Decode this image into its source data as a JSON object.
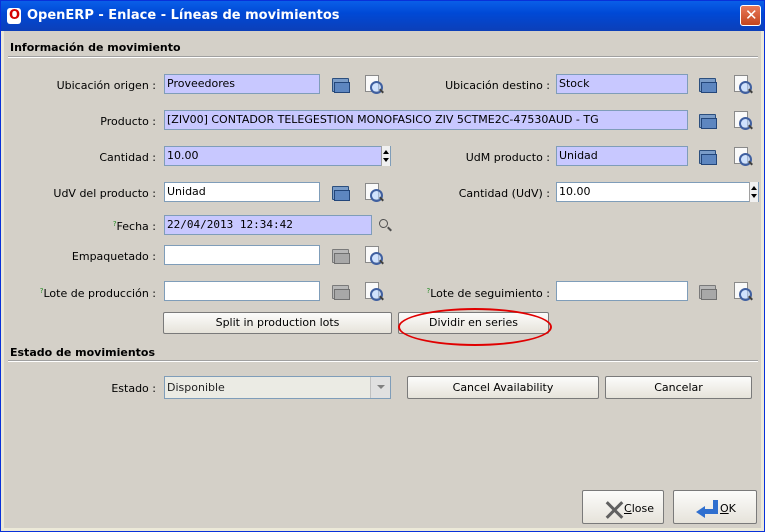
{
  "window": {
    "title": "OpenERP - Enlace - Líneas de movimientos",
    "logo_letter": "O",
    "close_glyph": "✕"
  },
  "section1": {
    "title": "Información de movimiento"
  },
  "section2": {
    "title": "Estado de movimientos"
  },
  "fields": {
    "ubicacion_origen": {
      "label": "Ubicación origen :",
      "value": "Proveedores"
    },
    "ubicacion_destino": {
      "label": "Ubicación destino :",
      "value": "Stock"
    },
    "producto": {
      "label": "Producto :",
      "value": "[ZIV00] CONTADOR TELEGESTION MONOFASICO ZIV 5CTME2C-47530AUD - TG"
    },
    "cantidad": {
      "label": "Cantidad :",
      "value": "10.00"
    },
    "udm_producto": {
      "label": "UdM producto :",
      "value": "Unidad"
    },
    "udv_producto": {
      "label": "UdV del producto :",
      "value": "Unidad"
    },
    "cantidad_udv": {
      "label": "Cantidad (UdV) :",
      "value": "10.00"
    },
    "fecha": {
      "label_mark": "?",
      "label": "Fecha :",
      "value": "22/04/2013 12:34:42"
    },
    "empaquetado": {
      "label": "Empaquetado :",
      "value": ""
    },
    "lote_produccion": {
      "label_mark": "?",
      "label": "Lote de producción :",
      "value": ""
    },
    "lote_seguimiento": {
      "label_mark": "?",
      "label": "Lote de seguimiento :",
      "value": ""
    },
    "estado": {
      "label": "Estado :",
      "value": "Disponible"
    }
  },
  "buttons": {
    "split_production": "Split in production lots",
    "dividir_series": "Dividir en series",
    "cancel_availability": "Cancel Availability",
    "cancelar": "Cancelar",
    "close_accel": "C",
    "close_rest": "lose",
    "ok_accel": "O",
    "ok_rest": "K"
  },
  "colors": {
    "required_field": "#c8c8ff",
    "highlight_circle": "#e00000",
    "title_bar": "#0a5fe8"
  },
  "icons": [
    "folder-icon",
    "search-icon",
    "zoom-icon",
    "close-x-icon",
    "ok-arrow-icon"
  ]
}
